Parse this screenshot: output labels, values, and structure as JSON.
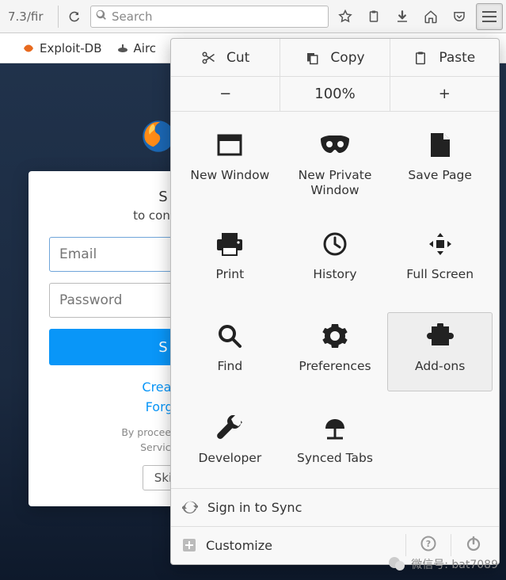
{
  "toolbar": {
    "url_fragment": "7.3/fir",
    "search_placeholder": "Search"
  },
  "bookmarks": {
    "items": [
      {
        "label": "Exploit-DB"
      },
      {
        "label": "Airc"
      }
    ]
  },
  "signin": {
    "heading_fragment": "S",
    "subtitle_fragment": "to continu",
    "email_placeholder": "Email",
    "password_placeholder": "Password",
    "submit_fragment": "S",
    "create_link_fragment": "Create",
    "forgot_link_fragment": "Forgo",
    "fineprint_line1": "By proceeding, y",
    "fineprint_line2": "Service a",
    "skip_fragment": "Ski"
  },
  "menu": {
    "edit": {
      "cut": "Cut",
      "copy": "Copy",
      "paste": "Paste"
    },
    "zoom": {
      "minus": "−",
      "level": "100%",
      "plus": "+"
    },
    "grid": [
      {
        "label": "New Window"
      },
      {
        "label": "New Private Window"
      },
      {
        "label": "Save Page"
      },
      {
        "label": "Print"
      },
      {
        "label": "History"
      },
      {
        "label": "Full Screen"
      },
      {
        "label": "Find"
      },
      {
        "label": "Preferences"
      },
      {
        "label": "Add-ons",
        "highlight": true
      },
      {
        "label": "Developer"
      },
      {
        "label": "Synced Tabs"
      }
    ],
    "sync_label": "Sign in to Sync",
    "customize_label": "Customize"
  },
  "watermark": {
    "text": "微信号: bat7089"
  }
}
